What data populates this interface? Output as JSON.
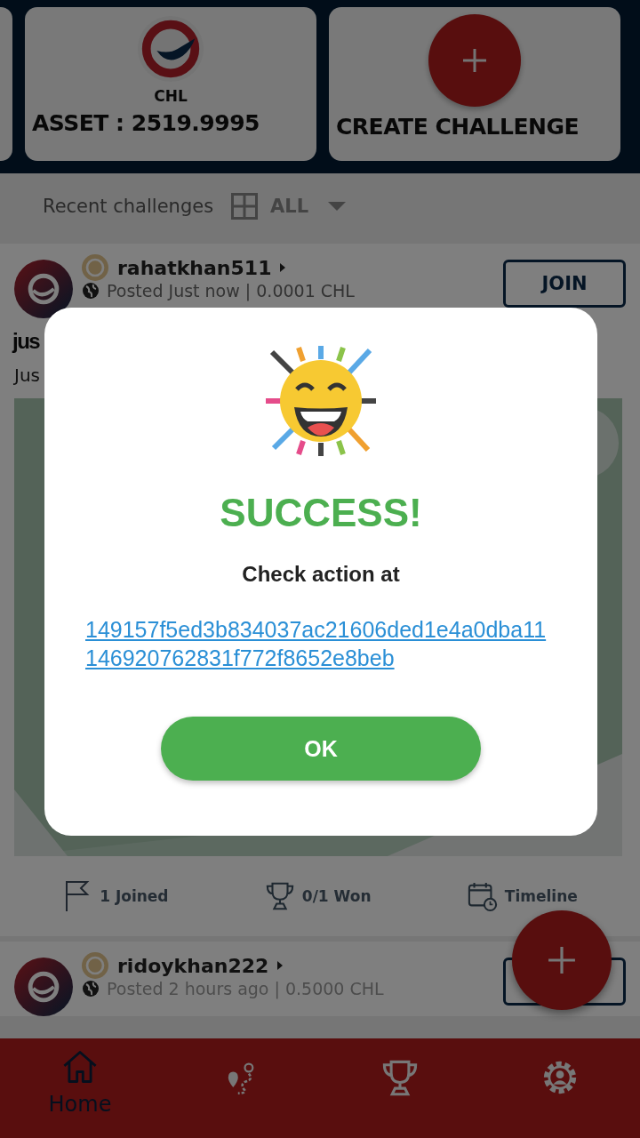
{
  "header": {
    "coin": "CHL",
    "asset": "ASSET : 2519.9995",
    "create_label": "CREATE CHALLENGE"
  },
  "filter": {
    "title": "Recent challenges",
    "value": "ALL"
  },
  "posts": [
    {
      "username": "rahatkhan511",
      "posted": "Posted Just now | 0.0001 CHL",
      "action": "JOIN",
      "title": "jus",
      "description": "Jus",
      "stats": [
        {
          "kind": "flag",
          "label": "1 Joined"
        },
        {
          "kind": "trophy",
          "label": "0/1 Won"
        },
        {
          "kind": "calendar",
          "label": "Timeline"
        }
      ]
    },
    {
      "username": "ridoykhan222",
      "posted": "Posted 2 hours ago | 0.5000 CHL"
    }
  ],
  "nav": [
    {
      "kind": "home",
      "label": "Home",
      "selected": true
    },
    {
      "kind": "route",
      "selected": false
    },
    {
      "kind": "trophy",
      "selected": false
    },
    {
      "kind": "settings",
      "selected": false
    }
  ],
  "dialog": {
    "title": "SUCCESS!",
    "message": "Check action at",
    "link": "149157f5ed3b834037ac21606ded1e4a0dba11146920762831f772f8652e8beb",
    "button": "OK"
  }
}
